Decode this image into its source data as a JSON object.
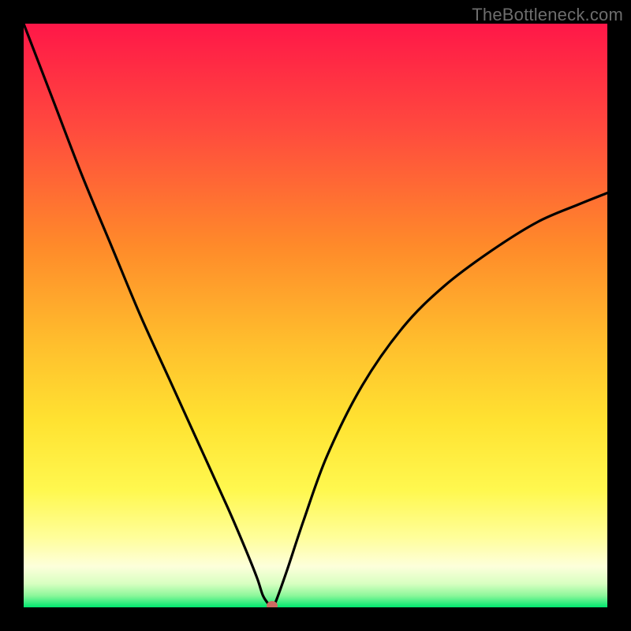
{
  "watermark": "TheBottleneck.com",
  "chart_data": {
    "type": "line",
    "title": "",
    "xlabel": "",
    "ylabel": "",
    "xlim": [
      0,
      100
    ],
    "ylim": [
      0,
      100
    ],
    "legend": false,
    "grid": false,
    "background_gradient": {
      "top": "#ff1748",
      "mid_top": "#ff8a2a",
      "mid": "#ffe231",
      "mid_low": "#fffe7a",
      "low": "#fdffdb",
      "bottom": "#00e76f"
    },
    "optimum_point": {
      "x": 42.5,
      "y": 0,
      "color": "#cd6a62"
    },
    "series": [
      {
        "name": "bottleneck-curve",
        "color": "#000000",
        "x": [
          0,
          5,
          10,
          15,
          20,
          25,
          30,
          35,
          38,
          40,
          41,
          42,
          42.5,
          43,
          45,
          48,
          52,
          58,
          65,
          72,
          80,
          88,
          95,
          100
        ],
        "y": [
          100,
          87,
          74,
          62,
          50,
          39,
          28,
          17,
          10,
          5,
          2,
          0.5,
          0,
          0.5,
          6,
          15,
          26,
          38,
          48,
          55,
          61,
          66,
          69,
          71
        ]
      }
    ]
  }
}
